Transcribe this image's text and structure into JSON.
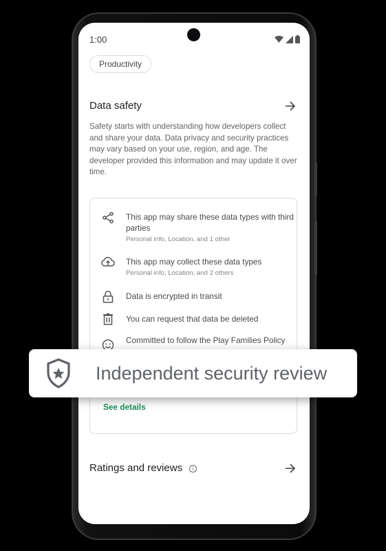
{
  "status_bar": {
    "time": "1:00",
    "icons": [
      "wifi-icon",
      "signal-icon",
      "battery-icon"
    ]
  },
  "category_chip": "Productivity",
  "data_safety": {
    "title": "Data safety",
    "description": "Safety starts with understanding how developers collect and share your data. Data privacy and security practices may vary based on your use, region, and age. The developer provided this information and may update it over time.",
    "items": [
      {
        "icon": "share-icon",
        "main": "This app may share these data types with third parties",
        "sub": "Personal info, Location, and 1 other"
      },
      {
        "icon": "cloud-upload-icon",
        "main": "This app may collect these data types",
        "sub": "Personal info, Location, and 2 others"
      },
      {
        "icon": "lock-icon",
        "main": "Data is encrypted in transit"
      },
      {
        "icon": "trash-icon",
        "main": "You can request that data be deleted"
      },
      {
        "icon": "families-icon",
        "main": "Committed to follow the Play Families Policy"
      }
    ],
    "see_details": "See details"
  },
  "overlay_badge": {
    "icon": "shield-star-icon",
    "label": "Independent security review"
  },
  "ratings": {
    "title": "Ratings and reviews",
    "info_glyph": "i"
  }
}
